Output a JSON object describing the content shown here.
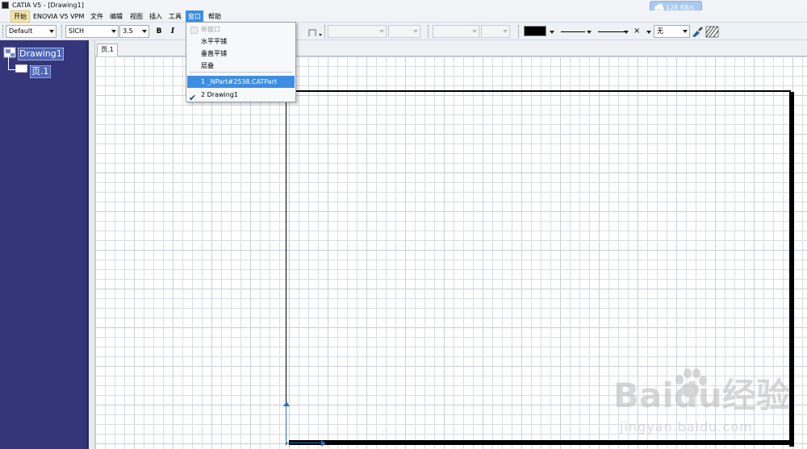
{
  "titlebar": {
    "title": "CATIA V5 - [Drawing1]"
  },
  "speed_widget": {
    "speed": "128 KB/s",
    "icon": "cloud-icon",
    "color": "#a9c9ee"
  },
  "menubar": {
    "items": [
      "开始",
      "ENOVIA V5 VPM",
      "文件",
      "编辑",
      "视图",
      "插入",
      "工具",
      "窗口",
      "帮助"
    ],
    "active_index": 7
  },
  "toolbar": {
    "style_value": "Default",
    "font_value": "SICH",
    "size_value": "3.5",
    "bold_label": "B",
    "italic_label": "I",
    "color_value": "#000000",
    "linetype_value": "×",
    "fill_value": "无"
  },
  "tree": {
    "root_label": "Drawing1",
    "child_label": "页.1",
    "accent": "#35357a"
  },
  "sheet_tab": {
    "label": "页.1"
  },
  "window_menu": {
    "items": [
      {
        "label": "新窗口",
        "state": "disabled"
      },
      {
        "label": "水平平铺",
        "state": "normal"
      },
      {
        "label": "垂直平铺",
        "state": "normal"
      },
      {
        "label": "层叠",
        "state": "normal"
      },
      {
        "label": "1 _NPart#2538.CATPart",
        "state": "highlight"
      },
      {
        "label": "2 Drawing1",
        "state": "checked"
      }
    ],
    "highlight_color": "#3d8ee2"
  },
  "watermark": {
    "brand": "Baidu经验",
    "url": "jingyan.baidu.com"
  }
}
